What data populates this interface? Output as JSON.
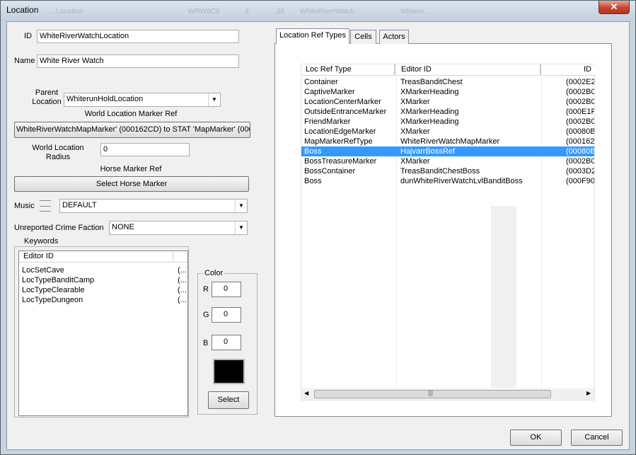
{
  "window": {
    "title": "Location",
    "close_label": "✕",
    "ghost_text": [
      "...Location",
      "WRW9C9",
      "3",
      "28",
      "WhiteRiverWatch",
      "Whitew..."
    ]
  },
  "form": {
    "id_label": "ID",
    "id_value": "WhiteRiverWatchLocation",
    "name_label": "Name",
    "name_value": "White River Watch",
    "parent_label_1": "Parent",
    "parent_label_2": "Location",
    "parent_value": "WhiterunHoldLocation",
    "marker_ref_label": "World Location Marker Ref",
    "marker_ref_button": "WhiteRiverWatchMapMarker' (000162CD) to STAT 'MapMarker' (0000",
    "radius_label_1": "World Location",
    "radius_label_2": "Radius",
    "radius_value": "0",
    "horse_label": "Horse Marker Ref",
    "horse_button": "Select Horse Marker",
    "music_label": "Music",
    "music_value": "DEFAULT",
    "crime_label": "Unreported Crime Faction",
    "crime_value": "NONE"
  },
  "keywords": {
    "group_label": "Keywords",
    "header": "Editor ID",
    "items": [
      {
        "id": "LocSetCave",
        "extra": "(..."
      },
      {
        "id": "LocTypeBanditCamp",
        "extra": "(..."
      },
      {
        "id": "LocTypeClearable",
        "extra": "(..."
      },
      {
        "id": "LocTypeDungeon",
        "extra": "(..."
      }
    ]
  },
  "color": {
    "group_label": "Color",
    "r_label": "R",
    "r_value": "0",
    "g_label": "G",
    "g_value": "0",
    "b_label": "B",
    "b_value": "0",
    "swatch": "#000000",
    "select_label": "Select"
  },
  "tabs": [
    {
      "label": "Location Ref Types",
      "active": true
    },
    {
      "label": "Cells",
      "active": false
    },
    {
      "label": "Actors",
      "active": false
    }
  ],
  "loc_ref_table": {
    "headers": [
      "Loc Ref Type",
      "Editor ID",
      "ID"
    ],
    "selected_index": 7,
    "rows": [
      {
        "type": "Container",
        "editor_id": "TreasBanditChest",
        "id": "(0002E2"
      },
      {
        "type": "CaptiveMarker",
        "editor_id": "XMarkerHeading",
        "id": "(0002B0"
      },
      {
        "type": "LocationCenterMarker",
        "editor_id": "XMarker",
        "id": "(0002B0"
      },
      {
        "type": "OutsideEntranceMarker",
        "editor_id": "XMarkerHeading",
        "id": "(000E1F"
      },
      {
        "type": "FriendMarker",
        "editor_id": "XMarkerHeading",
        "id": "(0002B0"
      },
      {
        "type": "LocationEdgeMarker",
        "editor_id": "XMarker",
        "id": "(00080B"
      },
      {
        "type": "MapMarkerRefType",
        "editor_id": "WhiteRiverWatchMapMarker",
        "id": "(000162"
      },
      {
        "type": "Boss",
        "editor_id": "HajvarrBossRef",
        "id": "(00080B"
      },
      {
        "type": "BossTreasureMarker",
        "editor_id": "XMarker",
        "id": "(0002B0"
      },
      {
        "type": "BossContainer",
        "editor_id": "TreasBanditChestBoss",
        "id": "(0003D2"
      },
      {
        "type": "Boss",
        "editor_id": "dunWhiteRiverWatchLvlBanditBoss",
        "id": "(000F90"
      }
    ]
  },
  "footer": {
    "ok_label": "OK",
    "cancel_label": "Cancel"
  },
  "colors": {
    "selection": "#3399ff",
    "title_bar": "#c7d3de"
  }
}
